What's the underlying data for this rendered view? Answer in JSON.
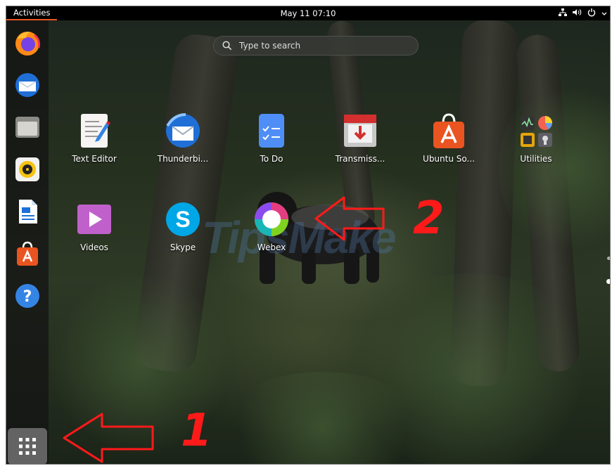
{
  "topbar": {
    "activities": "Activities",
    "clock": "May 11  07:10",
    "tray_icons": [
      "network-icon",
      "volume-icon",
      "power-icon"
    ]
  },
  "dock": {
    "items": [
      "firefox-icon",
      "thunderbird-icon",
      "files-icon",
      "rhythmbox-icon",
      "writer-icon",
      "software-icon",
      "help-icon"
    ],
    "show_apps": "show-applications-icon"
  },
  "search": {
    "placeholder": "Type to search"
  },
  "apps": [
    {
      "label": "Text Editor",
      "icon": "text-editor-icon"
    },
    {
      "label": "Thunderbi...",
      "icon": "thunderbird-icon"
    },
    {
      "label": "To Do",
      "icon": "todo-icon"
    },
    {
      "label": "Transmiss...",
      "icon": "transmission-icon"
    },
    {
      "label": "Ubuntu So...",
      "icon": "ubuntu-software-icon"
    },
    {
      "label": "Utilities",
      "icon": "utilities-icon"
    },
    {
      "label": "Videos",
      "icon": "videos-icon"
    },
    {
      "label": "Skype",
      "icon": "skype-icon"
    },
    {
      "label": "Webex",
      "icon": "webex-icon"
    }
  ],
  "annotations": {
    "one": "1",
    "two": "2"
  },
  "watermark": "TipsMake",
  "colors": {
    "accent": "#e95420",
    "annotation": "#ff1a1a"
  }
}
